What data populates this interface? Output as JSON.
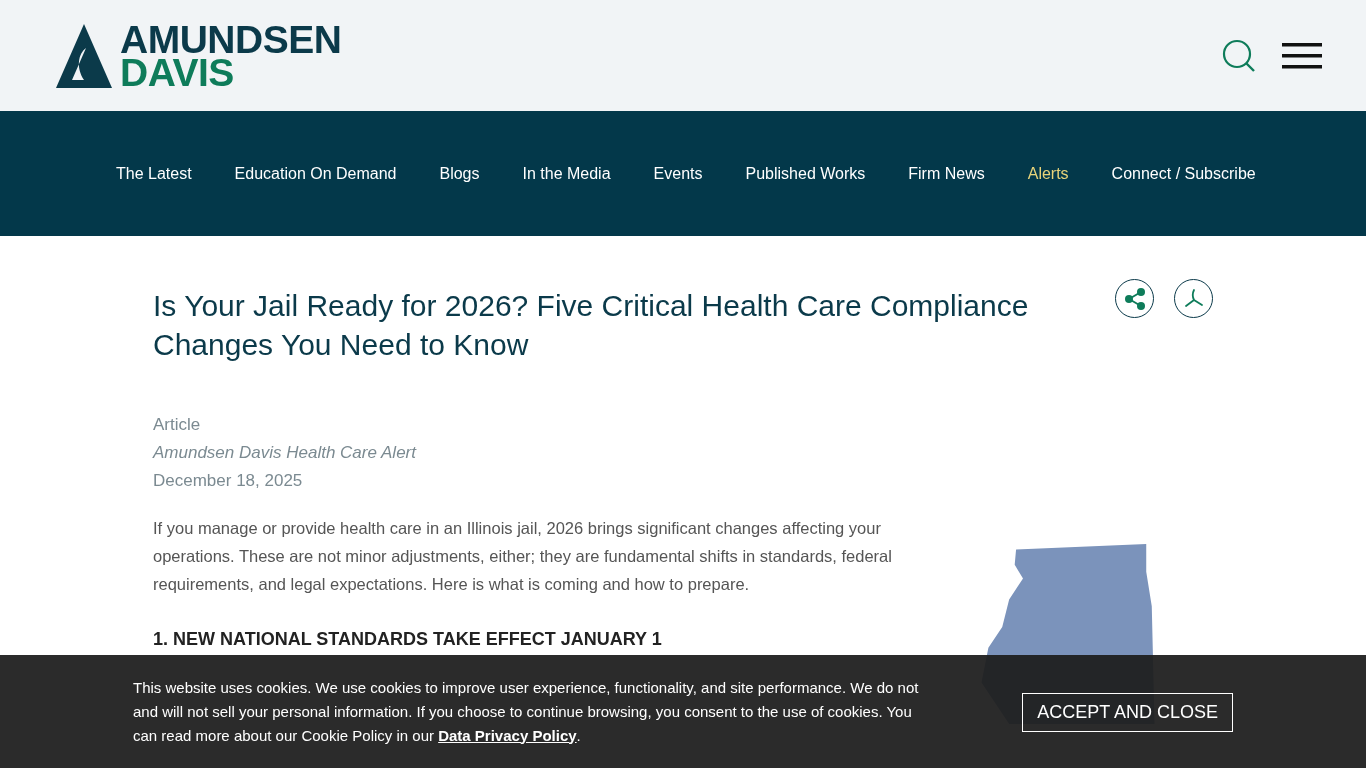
{
  "header": {
    "logo": {
      "line_1": "AMUNDSEN",
      "line_2": "DAVIS"
    }
  },
  "nav": [
    {
      "label": "The Latest",
      "selected": false
    },
    {
      "label": "Education On Demand",
      "selected": false
    },
    {
      "label": "Blogs",
      "selected": false
    },
    {
      "label": "In the Media",
      "selected": false
    },
    {
      "label": "Events",
      "selected": false
    },
    {
      "label": "Published Works",
      "selected": false
    },
    {
      "label": "Firm News",
      "selected": false
    },
    {
      "label": "Alerts",
      "selected": true
    },
    {
      "label": "Connect / Subscribe",
      "selected": false
    }
  ],
  "article": {
    "title": "Is Your Jail Ready for 2026? Five Critical Health Care Compliance Changes You Need to Know",
    "type": "Article",
    "series": "Amundsen Davis Health Care Alert",
    "date": "December 18, 2025",
    "intro": "If you manage or provide health care in an Illinois jail, 2026 brings significant changes affecting your operations. These are not minor adjustments, either; they are fundamental shifts in standards, federal requirements, and legal expectations. Here is what is coming and how to prepare.",
    "section_heading": "1. NEW NATIONAL STANDARDS TAKE EFFECT JANUARY 1"
  },
  "cookie_banner": {
    "text": "This website uses cookies. We use cookies to improve user experience, functionality, and site performance. We do not and will not sell your personal information. If you choose to continue browsing, you consent to the use of cookies. You can read more about our Cookie Policy in our ",
    "link": "Data Privacy Policy",
    "after_link": ".",
    "button": "ACCEPT AND CLOSE"
  }
}
